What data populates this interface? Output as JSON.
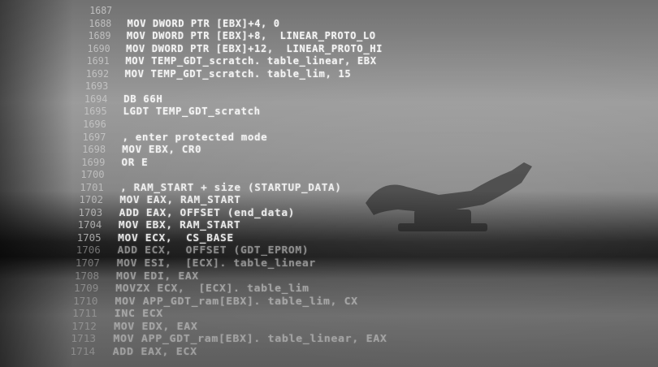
{
  "code_lines": [
    {
      "number": "1687",
      "code": ""
    },
    {
      "number": "1688",
      "code": "MOV DWORD PTR [EBX]+4, 0"
    },
    {
      "number": "1689",
      "code": "MOV DWORD PTR [EBX]+8,  LINEAR_PROTO_LO"
    },
    {
      "number": "1690",
      "code": "MOV DWORD PTR [EBX]+12,  LINEAR_PROTO_HI"
    },
    {
      "number": "1691",
      "code": "MOV TEMP_GDT_scratch. table_linear, EBX"
    },
    {
      "number": "1692",
      "code": "MOV TEMP_GDT_scratch. table_lim, 15"
    },
    {
      "number": "1693",
      "code": ""
    },
    {
      "number": "1694",
      "code": "DB 66H"
    },
    {
      "number": "1695",
      "code": "LGDT TEMP_GDT_scratch"
    },
    {
      "number": "1696",
      "code": ""
    },
    {
      "number": "1697",
      "code": ", enter protected mode"
    },
    {
      "number": "1698",
      "code": "MOV EBX, CR0"
    },
    {
      "number": "1699",
      "code": "OR E"
    },
    {
      "number": "1700",
      "code": ""
    },
    {
      "number": "1701",
      "code": ", RAM_START + size (STARTUP_DATA)"
    },
    {
      "number": "1702",
      "code": "MOV EAX, RAM_START"
    },
    {
      "number": "1703",
      "code": "ADD EAX, OFFSET (end_data)"
    },
    {
      "number": "1704",
      "code": "MOV EBX, RAM_START"
    },
    {
      "number": "1705",
      "code": "MOV ECX,  CS_BASE"
    },
    {
      "number": "1706",
      "code": "ADD ECX,  OFFSET (GDT_EPROM)"
    },
    {
      "number": "1707",
      "code": "MOV ESI,  [ECX]. table_linear"
    },
    {
      "number": "1708",
      "code": "MOV EDI, EAX"
    },
    {
      "number": "1709",
      "code": "MOVZX ECX,  [ECX]. table_lim"
    },
    {
      "number": "1710",
      "code": "MOV APP_GDT_ram[EBX]. table_lim, CX"
    },
    {
      "number": "1711",
      "code": "INC ECX"
    },
    {
      "number": "1712",
      "code": "MOV EDX, EAX"
    },
    {
      "number": "1713",
      "code": "MOV APP_GDT_ram[EBX]. table_linear, EAX"
    },
    {
      "number": "1714",
      "code": "ADD EAX, ECX"
    }
  ],
  "colors": {
    "text": "#f4f4f4",
    "line_number": "#c9c9c9"
  }
}
